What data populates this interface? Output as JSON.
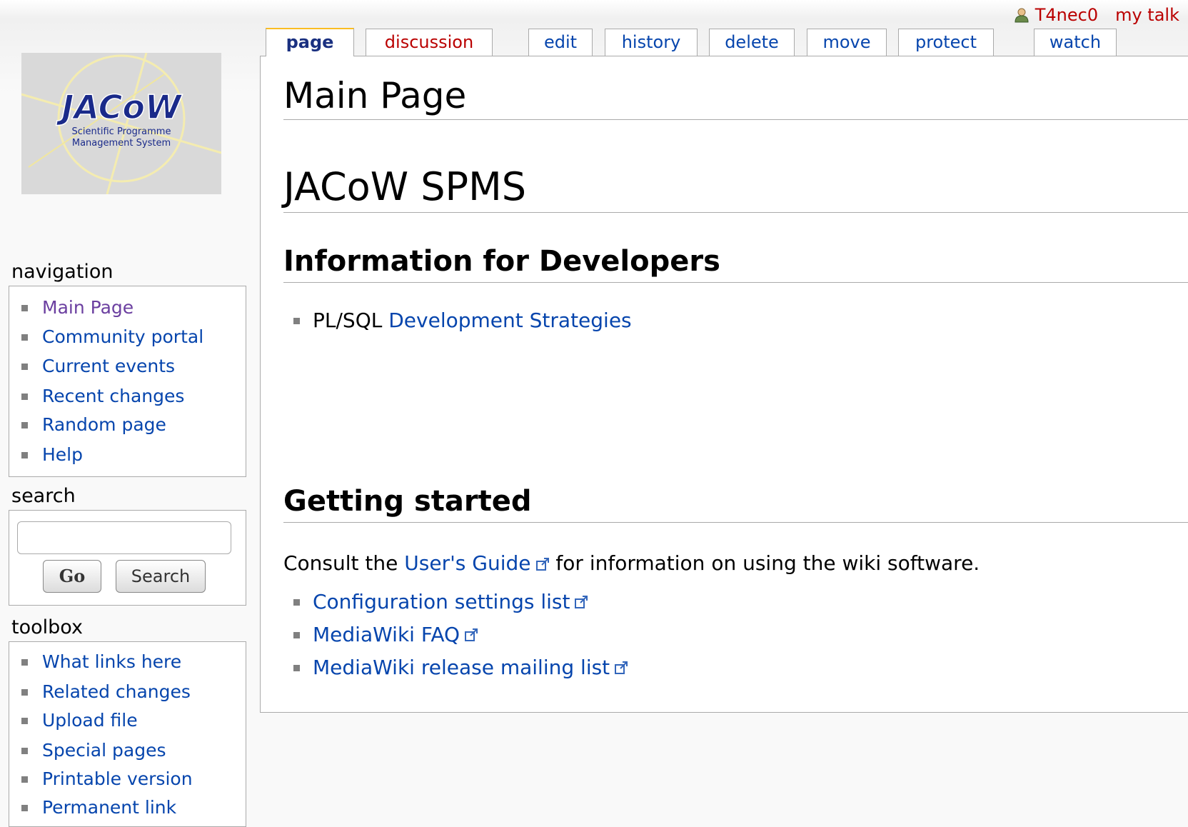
{
  "personal": {
    "username": "T4nec0",
    "my_talk": "my talk"
  },
  "tabs": [
    {
      "label": "page"
    },
    {
      "label": "discussion"
    },
    {
      "label": "edit"
    },
    {
      "label": "history"
    },
    {
      "label": "delete"
    },
    {
      "label": "move"
    },
    {
      "label": "protect"
    },
    {
      "label": "watch"
    }
  ],
  "logo": {
    "text": "JACoW",
    "line1": "Scientific Programme",
    "line2": "Management System"
  },
  "sidebar": {
    "navigation": {
      "title": "navigation",
      "items": [
        "Main Page",
        "Community portal",
        "Current events",
        "Recent changes",
        "Random page",
        "Help"
      ]
    },
    "search": {
      "title": "search",
      "input_value": "",
      "go_label": "Go",
      "search_label": "Search"
    },
    "toolbox": {
      "title": "toolbox",
      "items": [
        "What links here",
        "Related changes",
        "Upload file",
        "Special pages",
        "Printable version",
        "Permanent link"
      ]
    }
  },
  "content": {
    "title": "Main Page",
    "heading1": "JACoW SPMS",
    "section1": {
      "title": "Information for Developers",
      "item_prefix": "PL/SQL",
      "item_link": "Development Strategies"
    },
    "section2": {
      "title": "Getting started",
      "para_before": "Consult the",
      "para_link": "User's Guide",
      "para_after": "for information on using the wiki software.",
      "links": [
        "Configuration settings list",
        "MediaWiki FAQ",
        "MediaWiki release mailing list"
      ]
    }
  }
}
